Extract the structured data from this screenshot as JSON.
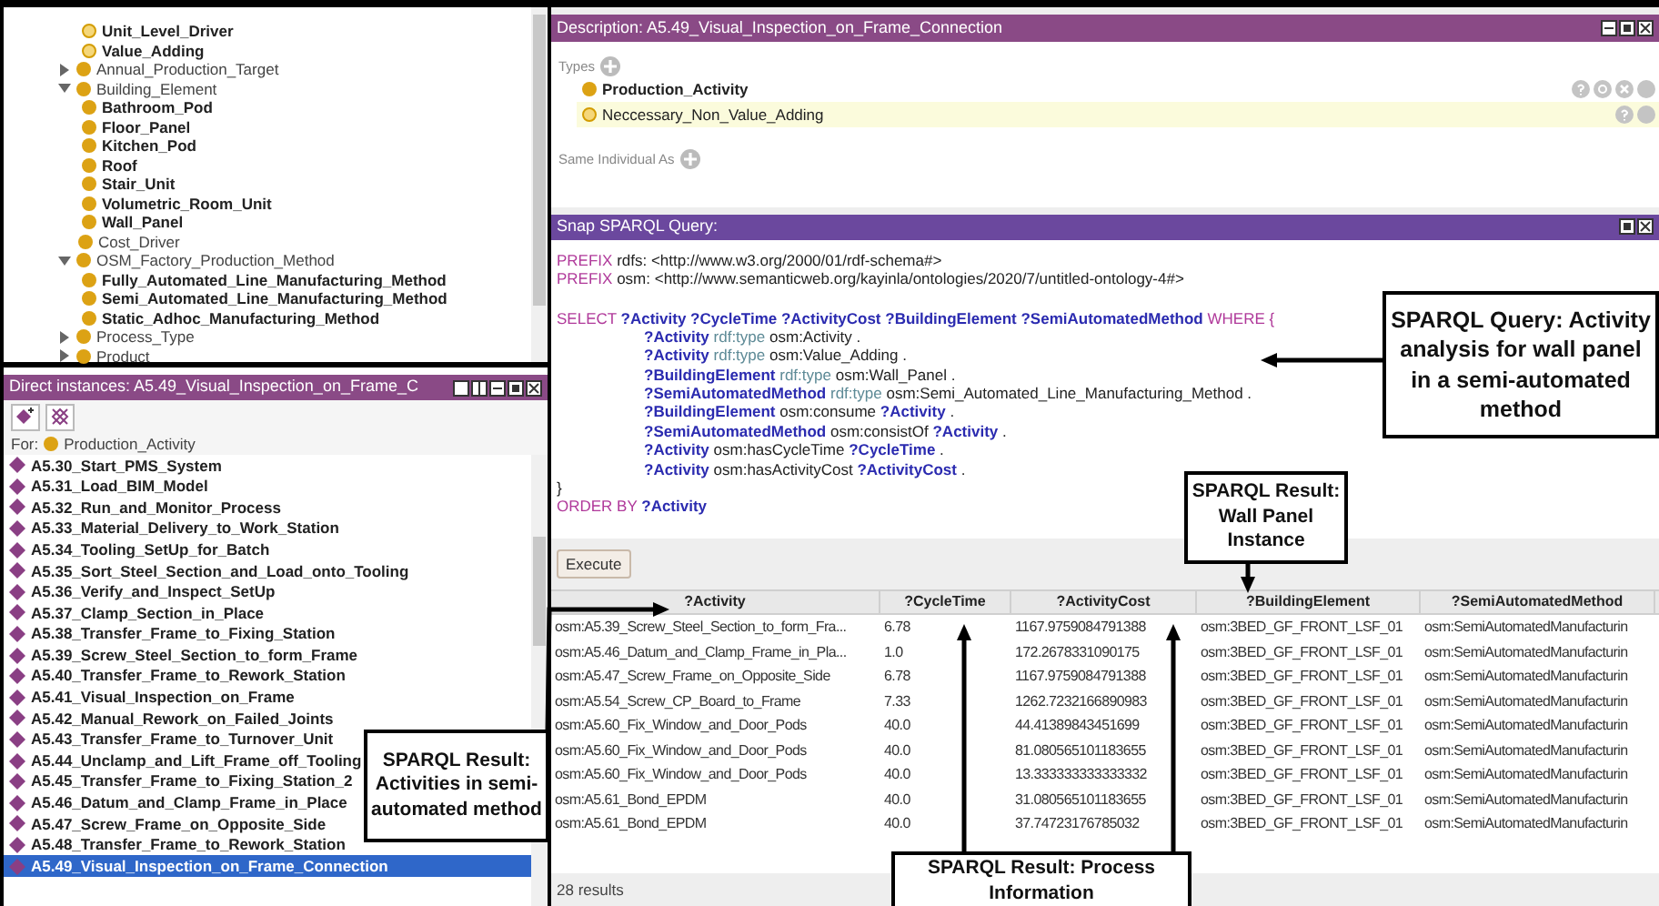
{
  "class_tree": {
    "continued": [
      {
        "label": "Unit_Level_Driver",
        "defined": true
      },
      {
        "label": "Value_Adding",
        "defined": true
      }
    ],
    "items": [
      {
        "label": "Annual_Production_Target",
        "expanded": false
      },
      {
        "label": "Building_Element",
        "expanded": true,
        "children": [
          {
            "label": "Bathroom_Pod"
          },
          {
            "label": "Floor_Panel"
          },
          {
            "label": "Kitchen_Pod"
          },
          {
            "label": "Roof"
          },
          {
            "label": "Stair_Unit"
          },
          {
            "label": "Volumetric_Room_Unit"
          },
          {
            "label": "Wall_Panel"
          }
        ]
      },
      {
        "label": "Cost_Driver"
      },
      {
        "label": "OSM_Factory_Production_Method",
        "expanded": true,
        "children": [
          {
            "label": "Fully_Automated_Line_Manufacturing_Method"
          },
          {
            "label": "Semi_Automated_Line_Manufacturing_Method"
          },
          {
            "label": "Static_Adhoc_Manufacturing_Method"
          }
        ]
      },
      {
        "label": "Process_Type",
        "expanded": false
      },
      {
        "label": "Product",
        "expanded": false
      }
    ]
  },
  "instances": {
    "title": "Direct instances: A5.49_Visual_Inspection_on_Frame_C",
    "for_label": "For:",
    "for_class": "Production_Activity",
    "items": [
      {
        "label": "A5.30_Start_PMS_System",
        "selected": false
      },
      {
        "label": "A5.31_Load_BIM_Model",
        "selected": false
      },
      {
        "label": "A5.32_Run_and_Monitor_Process",
        "selected": false
      },
      {
        "label": "A5.33_Material_Delivery_to_Work_Station",
        "selected": false
      },
      {
        "label": "A5.34_Tooling_SetUp_for_Batch",
        "selected": false
      },
      {
        "label": "A5.35_Sort_Steel_Section_and_Load_onto_Tooling",
        "selected": false
      },
      {
        "label": "A5.36_Verify_and_Inspect_SetUp",
        "selected": false
      },
      {
        "label": "A5.37_Clamp_Section_in_Place",
        "selected": false
      },
      {
        "label": "A5.38_Transfer_Frame_to_Fixing_Station",
        "selected": false
      },
      {
        "label": "A5.39_Screw_Steel_Section_to_form_Frame",
        "selected": false
      },
      {
        "label": "A5.40_Transfer_Frame_to_Rework_Station",
        "selected": false
      },
      {
        "label": "A5.41_Visual_Inspection_on_Frame",
        "selected": false
      },
      {
        "label": "A5.42_Manual_Rework_on_Failed_Joints",
        "selected": false
      },
      {
        "label": "A5.43_Transfer_Frame_to_Turnover_Unit",
        "selected": false
      },
      {
        "label": "A5.44_Unclamp_and_Lift_Frame_off_Tooling",
        "selected": false
      },
      {
        "label": "A5.45_Transfer_Frame_to_Fixing_Station_2",
        "selected": false
      },
      {
        "label": "A5.46_Datum_and_Clamp_Frame_in_Place",
        "selected": false
      },
      {
        "label": "A5.47_Screw_Frame_on_Opposite_Side",
        "selected": false
      },
      {
        "label": "A5.48_Transfer_Frame_to_Rework_Station",
        "selected": false
      },
      {
        "label": "A5.49_Visual_Inspection_on_Frame_Connection",
        "selected": true
      }
    ]
  },
  "description": {
    "title": "Description: A5.49_Visual_Inspection_on_Frame_Connection",
    "types_label": "Types",
    "types": [
      {
        "label": "Production_Activity",
        "defined": false,
        "highlighted": false
      },
      {
        "label": "Neccessary_Non_Value_Adding",
        "defined": true,
        "highlighted": true
      }
    ],
    "same_individual_label": "Same Individual As"
  },
  "query": {
    "title": "Snap SPARQL Query:",
    "lines": [
      {
        "kind": "prefix",
        "tokens": [
          {
            "kind": "keyword",
            "text": "PREFIX"
          },
          {
            "kind": "plain",
            "text": "rdfs: <http://www.w3.org/2000/01/rdf-schema#>"
          }
        ]
      },
      {
        "kind": "prefix",
        "tokens": [
          {
            "kind": "keyword",
            "text": "PREFIX"
          },
          {
            "kind": "plain",
            "text": "osm: <http://www.semanticweb.org/kayinla/ontologies/2020/7/untitled-ontology-4#>"
          }
        ]
      },
      {
        "kind": "select",
        "tokens": [
          {
            "kind": "keyword",
            "text": "SELECT"
          },
          {
            "kind": "variable",
            "text": "?Activity ?CycleTime ?ActivityCost ?BuildingElement ?SemiAutomatedMethod"
          },
          {
            "kind": "keyword",
            "text": "WHERE {"
          }
        ]
      },
      {
        "kind": "pattern",
        "tokens": [
          {
            "kind": "variable",
            "text": "?Activity"
          },
          {
            "kind": "builtin",
            "text": "rdf:type"
          },
          {
            "kind": "plain",
            "text": "osm:Activity ."
          }
        ]
      },
      {
        "kind": "pattern",
        "tokens": [
          {
            "kind": "variable",
            "text": "?Activity"
          },
          {
            "kind": "builtin",
            "text": "rdf:type"
          },
          {
            "kind": "plain",
            "text": "osm:Value_Adding ."
          }
        ]
      },
      {
        "kind": "pattern",
        "tokens": [
          {
            "kind": "variable",
            "text": "?BuildingElement"
          },
          {
            "kind": "builtin",
            "text": "rdf:type"
          },
          {
            "kind": "plain",
            "text": "osm:Wall_Panel ."
          }
        ]
      },
      {
        "kind": "pattern",
        "tokens": [
          {
            "kind": "variable",
            "text": "?SemiAutomatedMethod"
          },
          {
            "kind": "builtin",
            "text": "rdf:type"
          },
          {
            "kind": "plain",
            "text": "osm:Semi_Automated_Line_Manufacturing_Method ."
          }
        ]
      },
      {
        "kind": "pattern",
        "tokens": [
          {
            "kind": "variable",
            "text": "?BuildingElement"
          },
          {
            "kind": "plain",
            "text": "osm:consume"
          },
          {
            "kind": "variable",
            "text": "?Activity"
          },
          {
            "kind": "plain",
            "text": "."
          }
        ]
      },
      {
        "kind": "pattern",
        "tokens": [
          {
            "kind": "variable",
            "text": "?SemiAutomatedMethod"
          },
          {
            "kind": "plain",
            "text": "osm:consistOf"
          },
          {
            "kind": "variable",
            "text": "?Activity"
          },
          {
            "kind": "plain",
            "text": "."
          }
        ]
      },
      {
        "kind": "pattern",
        "tokens": [
          {
            "kind": "variable",
            "text": "?Activity"
          },
          {
            "kind": "plain",
            "text": "osm:hasCycleTime"
          },
          {
            "kind": "variable",
            "text": "?CycleTime"
          },
          {
            "kind": "plain",
            "text": "."
          }
        ]
      },
      {
        "kind": "pattern",
        "tokens": [
          {
            "kind": "variable",
            "text": "?Activity"
          },
          {
            "kind": "plain",
            "text": "osm:hasActivityCost"
          },
          {
            "kind": "variable",
            "text": "?ActivityCost"
          },
          {
            "kind": "plain",
            "text": "."
          }
        ]
      },
      {
        "kind": "close",
        "tokens": [
          {
            "kind": "plain",
            "text": "}"
          }
        ]
      },
      {
        "kind": "order",
        "tokens": [
          {
            "kind": "keyword",
            "text": "ORDER BY"
          },
          {
            "kind": "variable",
            "text": "?Activity"
          }
        ]
      }
    ],
    "execute_button": "Execute"
  },
  "results": {
    "columns": [
      "?Activity",
      "?CycleTime",
      "?ActivityCost",
      "?BuildingElement",
      "?SemiAutomatedMethod"
    ],
    "rows": [
      [
        "osm:A5.39_Screw_Steel_Section_to_form_Fra...",
        "6.78",
        "1167.9759084791388",
        "osm:3BED_GF_FRONT_LSF_01",
        "osm:SemiAutomatedManufacturin"
      ],
      [
        "osm:A5.46_Datum_and_Clamp_Frame_in_Pla...",
        "1.0",
        "172.2678331090175",
        "osm:3BED_GF_FRONT_LSF_01",
        "osm:SemiAutomatedManufacturin"
      ],
      [
        "osm:A5.47_Screw_Frame_on_Opposite_Side",
        "6.78",
        "1167.9759084791388",
        "osm:3BED_GF_FRONT_LSF_01",
        "osm:SemiAutomatedManufacturin"
      ],
      [
        "osm:A5.54_Screw_CP_Board_to_Frame",
        "7.33",
        "1262.7232166890983",
        "osm:3BED_GF_FRONT_LSF_01",
        "osm:SemiAutomatedManufacturin"
      ],
      [
        "osm:A5.60_Fix_Window_and_Door_Pods",
        "40.0",
        "44.41389843451699",
        "osm:3BED_GF_FRONT_LSF_01",
        "osm:SemiAutomatedManufacturin"
      ],
      [
        "osm:A5.60_Fix_Window_and_Door_Pods",
        "40.0",
        "81.080565101183655",
        "osm:3BED_GF_FRONT_LSF_01",
        "osm:SemiAutomatedManufacturin"
      ],
      [
        "osm:A5.60_Fix_Window_and_Door_Pods",
        "40.0",
        "13.333333333333332",
        "osm:3BED_GF_FRONT_LSF_01",
        "osm:SemiAutomatedManufacturin"
      ],
      [
        "osm:A5.61_Bond_EPDM",
        "40.0",
        "31.080565101183655",
        "osm:3BED_GF_FRONT_LSF_01",
        "osm:SemiAutomatedManufacturin"
      ],
      [
        "osm:A5.61_Bond_EPDM",
        "40.0",
        "37.74723176785032",
        "osm:3BED_GF_FRONT_LSF_01",
        "osm:SemiAutomatedManufacturin"
      ]
    ],
    "count": "28 results"
  },
  "annotations": [
    {
      "text": "SPARQL Query: Activity analysis for wall panel in a semi-automated method"
    },
    {
      "text": "SPARQL Result: Wall Panel Instance"
    },
    {
      "text": "SPARQL Result: Activities in semi-automated method"
    },
    {
      "text": "SPARQL Result: Process Information"
    }
  ]
}
